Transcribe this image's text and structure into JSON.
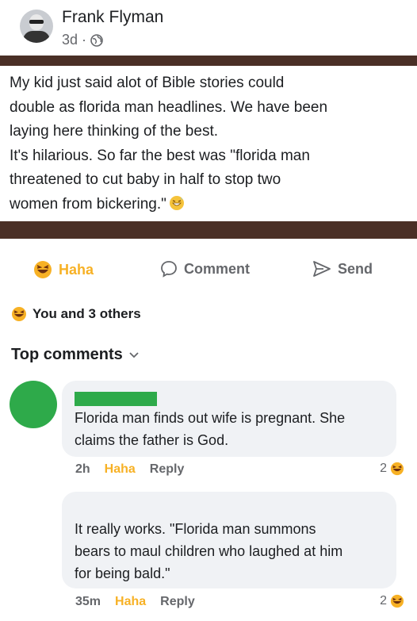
{
  "post": {
    "author": "Frank Flyman",
    "time": "3d",
    "separator": "·",
    "privacy_icon": "globe-icon",
    "text_lines": [
      "My kid just said alot of Bible stories could",
      "double as florida man headlines. We have been",
      "laying here thinking of the best.",
      "It's hilarious. So far the best was \"florida man",
      "threatened to cut baby in half to stop two",
      "women from bickering.\""
    ]
  },
  "actions": {
    "haha": "Haha",
    "comment": "Comment",
    "send": "Send"
  },
  "reactions": {
    "summary": "You and 3 others"
  },
  "comments_header": {
    "label": "Top comments"
  },
  "comments": [
    {
      "avatar_color": "#3f4bc8",
      "name_redaction_color": "#3f4bc8",
      "lines": [
        "Florida man finds out wife is pregnant. She",
        "claims the father is God."
      ],
      "time": "2h",
      "haha": "Haha",
      "reply": "Reply",
      "reaction_count": "2"
    },
    {
      "avatar_color": "#2eaa4a",
      "name_redaction_color": "#2eaa4a",
      "lines": [
        "It really works. \"Florida man summons",
        "bears to maul children who laughed at him",
        "for being bald.\""
      ],
      "time": "35m",
      "haha": "Haha",
      "reply": "Reply",
      "reaction_count": "2"
    }
  ],
  "colors": {
    "haha_yellow": "#f7b125",
    "secondary_text": "#65676b",
    "bubble_bg": "#f0f2f5",
    "image_band": "#4a2f26"
  }
}
